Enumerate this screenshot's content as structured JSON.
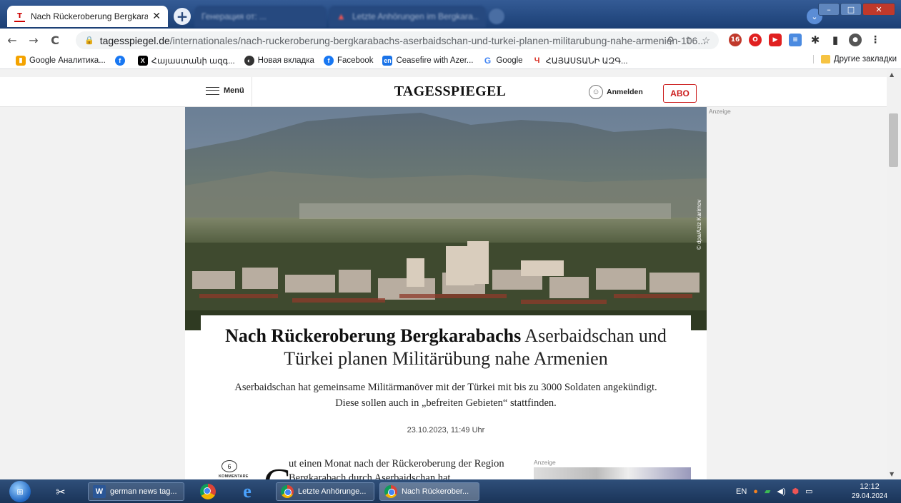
{
  "browser": {
    "active_tab": {
      "title": "Nach Rückeroberung Bergkaraba",
      "favicon": "T"
    },
    "inactive_tabs": [
      {
        "title": "Генерация от: ..."
      },
      {
        "title": "Letzte Anhörungen im Bergkara..."
      }
    ],
    "url": {
      "domain": "tagesspiegel.de",
      "path": "/internationales/nach-ruckeroberung-bergkarabachs-aserbaidschan-und-turkei-planen-militarubung-nahe-armenien-106..."
    },
    "bookmarks": [
      {
        "label": "Google Аналитика...",
        "icon": "analytics-icon",
        "color": "#f4a300"
      },
      {
        "label": "",
        "icon": "facebook-icon",
        "color": "#1877f2"
      },
      {
        "label": "Հայաստանի ազգ...",
        "icon": "x-icon",
        "color": "#000000"
      },
      {
        "label": "Новая вкладка",
        "icon": "globe-icon",
        "color": "#333333"
      },
      {
        "label": "Facebook",
        "icon": "facebook-icon",
        "color": "#1877f2"
      },
      {
        "label": "Ceasefire with Azer...",
        "icon": "en-icon",
        "color": "#1a73e8"
      },
      {
        "label": "Google",
        "icon": "google-icon",
        "color": "#4285f4"
      },
      {
        "label": "ՀԱՅԱՍՏԱՆԻ ԱԶԳ...",
        "icon": "logo-icon",
        "color": "#d93025"
      }
    ],
    "other_bookmarks": "Другие закладки"
  },
  "site": {
    "menu_label": "Menü",
    "logo": "TAGESSPIEGEL",
    "login_label": "Anmelden",
    "abo_label": "ABO",
    "ad_label": "Anzeige"
  },
  "article": {
    "photo_credit": "© dpa/Aziz Karimov",
    "headline_bold": "Nach Rückeroberung Bergkarabachs",
    "headline_rest": " Aserbaidschan und Türkei planen Militärübung nahe Armenien",
    "lead": "Aserbaidschan hat gemeinsame Militärmanöver mit der Türkei mit bis zu 3000 Soldaten angekündigt. Diese sollen auch in „befreiten Gebieten“ stattfinden.",
    "date": "23.10.2023, 11:49 Uhr",
    "comment_count": "6",
    "comment_label": "KOMMENTARE",
    "dropcap": "G",
    "body_start": "ut einen Monat nach der Rückeroberung der Region Bergkarabach durch Aserbaidschan hat",
    "ad_label": "Anzeige"
  },
  "taskbar": {
    "items": [
      {
        "label": "german news tag...",
        "icon": "word-icon"
      },
      {
        "label": "Letzte Anhörunge...",
        "icon": "chrome-icon"
      },
      {
        "label": "Nach Rückerober...",
        "icon": "chrome-icon"
      }
    ],
    "lang": "EN",
    "time": "12:12",
    "date": "29.04.2024"
  }
}
